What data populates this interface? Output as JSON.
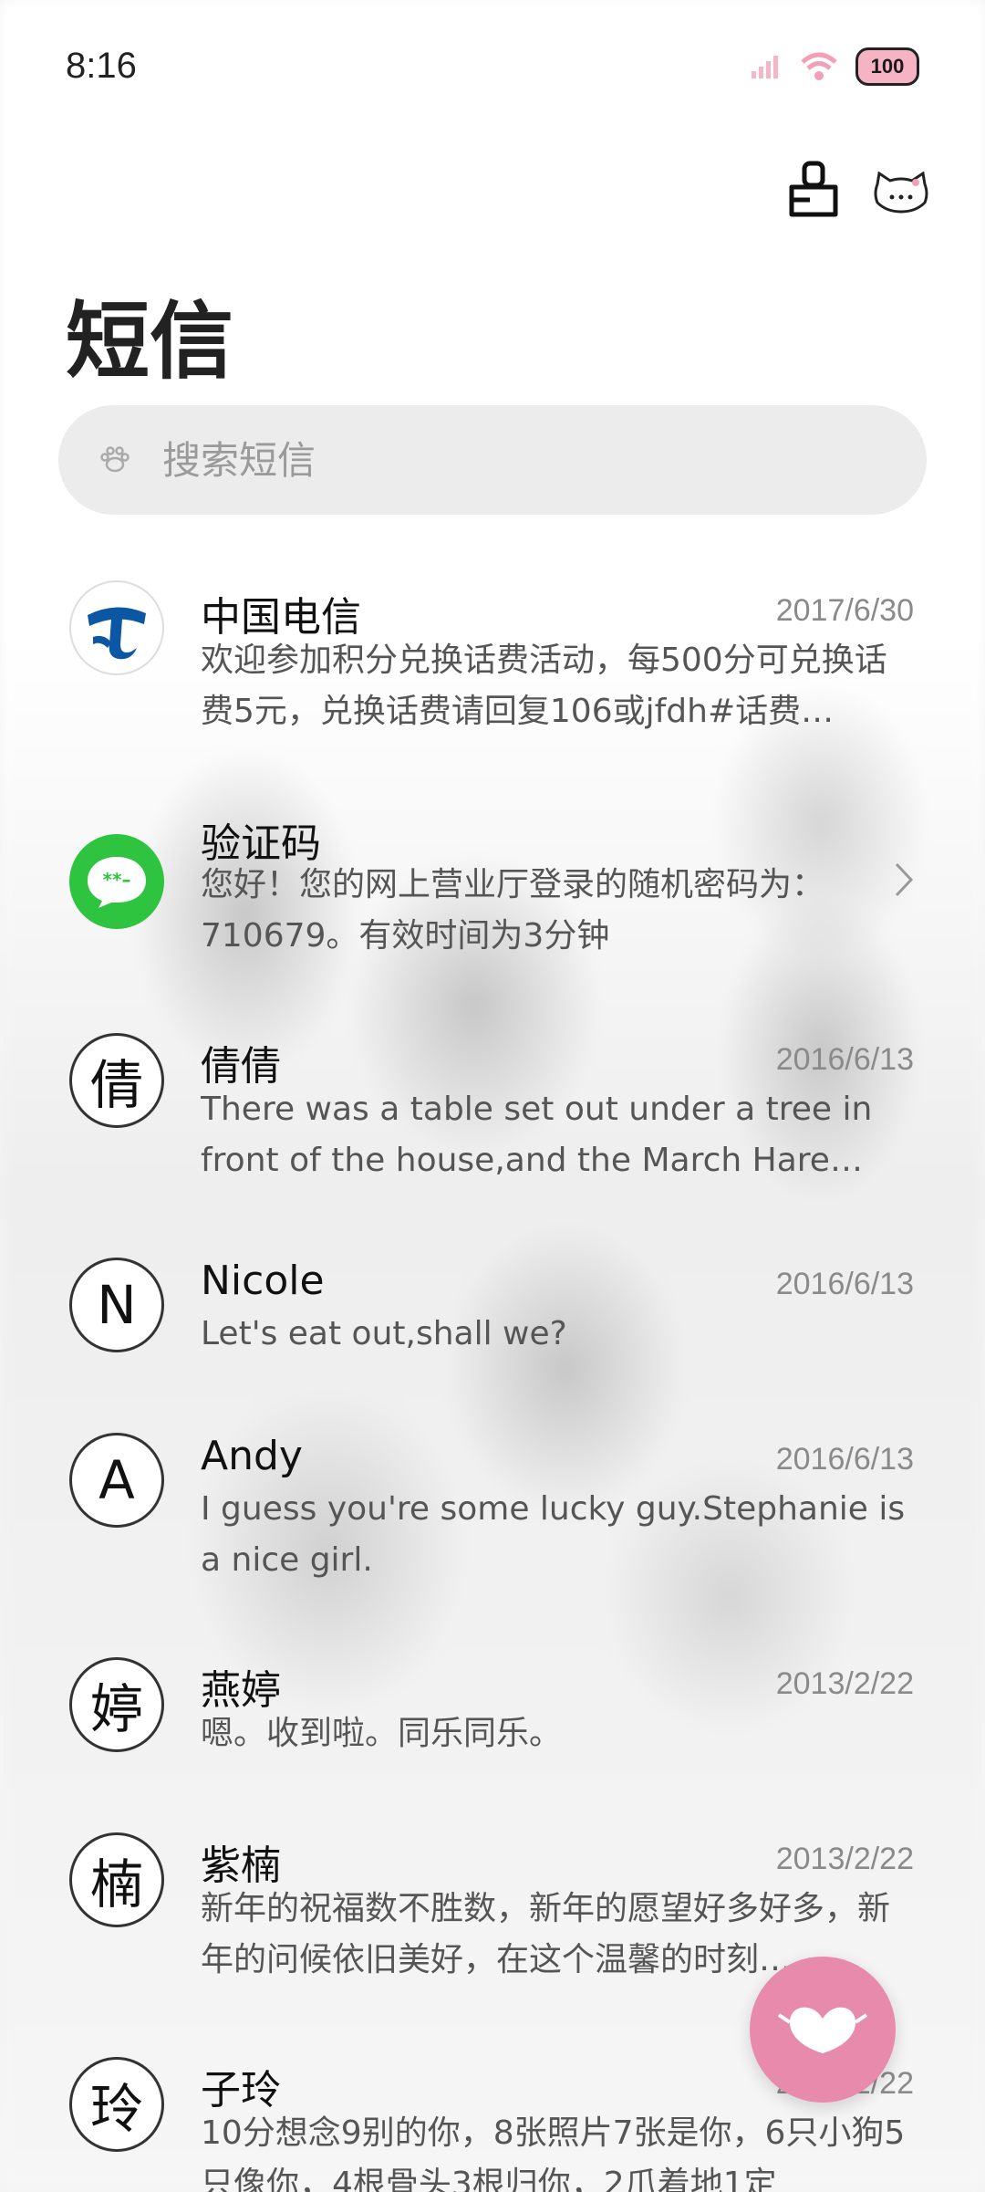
{
  "status_bar": {
    "time": "8:16",
    "battery": "100"
  },
  "header": {
    "title": "短信"
  },
  "search": {
    "placeholder": "搜索短信"
  },
  "conversations": [
    {
      "name": "中国电信",
      "date": "2017/6/30",
      "preview": "欢迎参加积分兑换话费活动，每500分可兑换话费5元，兑换话费请回复106或jfdh#话费…",
      "avatar": "china-telecom-logo"
    },
    {
      "name": "验证码",
      "date": "",
      "preview": "您好！您的网上营业厅登录的随机密码为：710679。有效时间为3分钟",
      "avatar_text": "**–"
    },
    {
      "name": "倩倩",
      "date": "2016/6/13",
      "preview": "There was a table set out under a tree in front of the house,and the March Hare an…",
      "avatar_text": "倩"
    },
    {
      "name": "Nicole",
      "date": "2016/6/13",
      "preview": "Let's eat out,shall we?",
      "avatar_text": "N"
    },
    {
      "name": "Andy",
      "date": "2016/6/13",
      "preview": "I guess you're some lucky guy.Stephanie is a nice girl.",
      "avatar_text": "A"
    },
    {
      "name": "燕婷",
      "date": "2013/2/22",
      "preview": "嗯。收到啦。同乐同乐。",
      "avatar_text": "婷"
    },
    {
      "name": "紫楠",
      "date": "2013/2/22",
      "preview": "新年的祝福数不胜数，新年的愿望好多好多，新年的问候依旧美好，在这个温馨的时刻……",
      "avatar_text": "楠"
    },
    {
      "name": "子玲",
      "date": "2013/2/22",
      "preview": "10分想念9别的你，8张照片7张是你，6只小狗5只像你，4根骨头3根归你，2爪着地1定",
      "avatar_text": "玲"
    }
  ]
}
